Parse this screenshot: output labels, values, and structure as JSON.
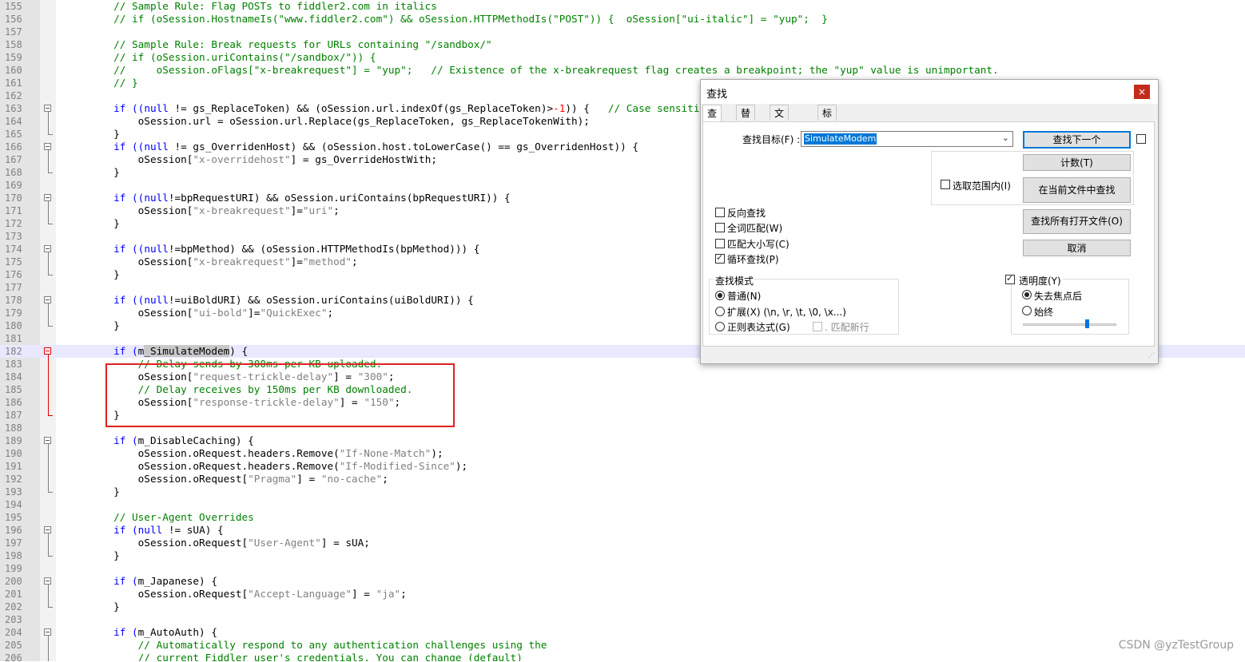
{
  "editor": {
    "lines": [
      {
        "n": "155",
        "tokens": [
          {
            "t": "comment",
            "v": "        // Sample Rule: Flag POSTs to fiddler2.com in italics"
          }
        ]
      },
      {
        "n": "156",
        "tokens": [
          {
            "t": "comment",
            "v": "        // if (oSession.HostnameIs(\"www.fiddler2.com\") && oSession.HTTPMethodIs(\"POST\")) {  oSession[\"ui-italic\"] = \"yup\";  }"
          }
        ]
      },
      {
        "n": "157",
        "tokens": []
      },
      {
        "n": "158",
        "tokens": [
          {
            "t": "comment",
            "v": "        // Sample Rule: Break requests for URLs containing \"/sandbox/\""
          }
        ]
      },
      {
        "n": "159",
        "tokens": [
          {
            "t": "comment",
            "v": "        // if (oSession.uriContains(\"/sandbox/\")) {"
          }
        ]
      },
      {
        "n": "160",
        "tokens": [
          {
            "t": "comment",
            "v": "        //     oSession.oFlags[\"x-breakrequest\"] = \"yup\";   // Existence of the x-breakrequest flag creates a breakpoint; the \"yup\" value is unimportant."
          }
        ]
      },
      {
        "n": "161",
        "tokens": [
          {
            "t": "comment",
            "v": "        // }"
          }
        ]
      },
      {
        "n": "162",
        "tokens": []
      },
      {
        "n": "163",
        "fold": "start",
        "tokens": [
          {
            "t": "kw",
            "v": "        if (("
          },
          {
            "t": "kw",
            "v": "null"
          },
          {
            "t": "text",
            "v": " != gs_ReplaceToken) && (oSession.url.indexOf(gs_ReplaceToken)>"
          },
          {
            "t": "num",
            "v": "-1"
          },
          {
            "t": "text",
            "v": ")) {   "
          },
          {
            "t": "comment",
            "v": "// Case sensitive"
          }
        ]
      },
      {
        "n": "164",
        "tokens": [
          {
            "t": "text",
            "v": "            oSession.url = oSession.url.Replace(gs_ReplaceToken, gs_ReplaceTokenWith);"
          }
        ]
      },
      {
        "n": "165",
        "fold": "end",
        "tokens": [
          {
            "t": "text",
            "v": "        }"
          }
        ]
      },
      {
        "n": "166",
        "fold": "start",
        "tokens": [
          {
            "t": "kw",
            "v": "        if (("
          },
          {
            "t": "kw",
            "v": "null"
          },
          {
            "t": "text",
            "v": " != gs_OverridenHost) && (oSession.host.toLowerCase() == gs_OverridenHost)) {"
          }
        ]
      },
      {
        "n": "167",
        "tokens": [
          {
            "t": "text",
            "v": "            oSession["
          },
          {
            "t": "str",
            "v": "\"x-overridehost\""
          },
          {
            "t": "text",
            "v": "] = gs_OverrideHostWith;"
          }
        ]
      },
      {
        "n": "168",
        "fold": "end",
        "tokens": [
          {
            "t": "text",
            "v": "        }"
          }
        ]
      },
      {
        "n": "169",
        "tokens": []
      },
      {
        "n": "170",
        "fold": "start",
        "tokens": [
          {
            "t": "kw",
            "v": "        if (("
          },
          {
            "t": "kw",
            "v": "null"
          },
          {
            "t": "text",
            "v": "!=bpRequestURI) && oSession.uriContains(bpRequestURI)) {"
          }
        ]
      },
      {
        "n": "171",
        "tokens": [
          {
            "t": "text",
            "v": "            oSession["
          },
          {
            "t": "str",
            "v": "\"x-breakrequest\""
          },
          {
            "t": "text",
            "v": "]="
          },
          {
            "t": "str",
            "v": "\"uri\""
          },
          {
            "t": "text",
            "v": ";"
          }
        ]
      },
      {
        "n": "172",
        "fold": "end",
        "tokens": [
          {
            "t": "text",
            "v": "        }"
          }
        ]
      },
      {
        "n": "173",
        "tokens": []
      },
      {
        "n": "174",
        "fold": "start",
        "tokens": [
          {
            "t": "kw",
            "v": "        if (("
          },
          {
            "t": "kw",
            "v": "null"
          },
          {
            "t": "text",
            "v": "!=bpMethod) && (oSession.HTTPMethodIs(bpMethod))) {"
          }
        ]
      },
      {
        "n": "175",
        "tokens": [
          {
            "t": "text",
            "v": "            oSession["
          },
          {
            "t": "str",
            "v": "\"x-breakrequest\""
          },
          {
            "t": "text",
            "v": "]="
          },
          {
            "t": "str",
            "v": "\"method\""
          },
          {
            "t": "text",
            "v": ";"
          }
        ]
      },
      {
        "n": "176",
        "fold": "end",
        "tokens": [
          {
            "t": "text",
            "v": "        }"
          }
        ]
      },
      {
        "n": "177",
        "tokens": []
      },
      {
        "n": "178",
        "fold": "start",
        "tokens": [
          {
            "t": "kw",
            "v": "        if (("
          },
          {
            "t": "kw",
            "v": "null"
          },
          {
            "t": "text",
            "v": "!=uiBoldURI) && oSession.uriContains(uiBoldURI)) {"
          }
        ]
      },
      {
        "n": "179",
        "tokens": [
          {
            "t": "text",
            "v": "            oSession["
          },
          {
            "t": "str",
            "v": "\"ui-bold\""
          },
          {
            "t": "text",
            "v": "]="
          },
          {
            "t": "str",
            "v": "\"QuickExec\""
          },
          {
            "t": "text",
            "v": ";"
          }
        ]
      },
      {
        "n": "180",
        "fold": "end",
        "tokens": [
          {
            "t": "text",
            "v": "        }"
          }
        ]
      },
      {
        "n": "181",
        "tokens": []
      },
      {
        "n": "182",
        "fold": "start-red",
        "current": true,
        "tokens": [
          {
            "t": "kw",
            "v": "        if ("
          },
          {
            "t": "text",
            "v": "m"
          },
          {
            "t": "hl",
            "v": "_SimulateModem"
          },
          {
            "t": "text",
            "v": ") {"
          }
        ]
      },
      {
        "n": "183",
        "tokens": [
          {
            "t": "comment",
            "v": "            // Delay sends by 300ms per KB uploaded."
          }
        ]
      },
      {
        "n": "184",
        "tokens": [
          {
            "t": "text",
            "v": "            oSession["
          },
          {
            "t": "str",
            "v": "\"request-trickle-delay\""
          },
          {
            "t": "text",
            "v": "] = "
          },
          {
            "t": "str",
            "v": "\"300\""
          },
          {
            "t": "text",
            "v": ";"
          }
        ]
      },
      {
        "n": "185",
        "tokens": [
          {
            "t": "comment",
            "v": "            // Delay receives by 150ms per KB downloaded."
          }
        ]
      },
      {
        "n": "186",
        "tokens": [
          {
            "t": "text",
            "v": "            oSession["
          },
          {
            "t": "str",
            "v": "\"response-trickle-delay\""
          },
          {
            "t": "text",
            "v": "] = "
          },
          {
            "t": "str",
            "v": "\"150\""
          },
          {
            "t": "text",
            "v": ";"
          }
        ]
      },
      {
        "n": "187",
        "fold": "end-red",
        "tokens": [
          {
            "t": "text",
            "v": "        }"
          }
        ]
      },
      {
        "n": "188",
        "tokens": []
      },
      {
        "n": "189",
        "fold": "start",
        "tokens": [
          {
            "t": "kw",
            "v": "        if ("
          },
          {
            "t": "text",
            "v": "m_DisableCaching) {"
          }
        ]
      },
      {
        "n": "190",
        "tokens": [
          {
            "t": "text",
            "v": "            oSession.oRequest.headers.Remove("
          },
          {
            "t": "str",
            "v": "\"If-None-Match\""
          },
          {
            "t": "text",
            "v": ");"
          }
        ]
      },
      {
        "n": "191",
        "tokens": [
          {
            "t": "text",
            "v": "            oSession.oRequest.headers.Remove("
          },
          {
            "t": "str",
            "v": "\"If-Modified-Since\""
          },
          {
            "t": "text",
            "v": ");"
          }
        ]
      },
      {
        "n": "192",
        "tokens": [
          {
            "t": "text",
            "v": "            oSession.oRequest["
          },
          {
            "t": "str",
            "v": "\"Pragma\""
          },
          {
            "t": "text",
            "v": "] = "
          },
          {
            "t": "str",
            "v": "\"no-cache\""
          },
          {
            "t": "text",
            "v": ";"
          }
        ]
      },
      {
        "n": "193",
        "fold": "end",
        "tokens": [
          {
            "t": "text",
            "v": "        }"
          }
        ]
      },
      {
        "n": "194",
        "tokens": []
      },
      {
        "n": "195",
        "tokens": [
          {
            "t": "comment",
            "v": "        // User-Agent Overrides"
          }
        ]
      },
      {
        "n": "196",
        "fold": "start",
        "tokens": [
          {
            "t": "kw",
            "v": "        if ("
          },
          {
            "t": "kw",
            "v": "null"
          },
          {
            "t": "text",
            "v": " != sUA) {"
          }
        ]
      },
      {
        "n": "197",
        "tokens": [
          {
            "t": "text",
            "v": "            oSession.oRequest["
          },
          {
            "t": "str",
            "v": "\"User-Agent\""
          },
          {
            "t": "text",
            "v": "] = sUA;"
          }
        ]
      },
      {
        "n": "198",
        "fold": "end",
        "tokens": [
          {
            "t": "text",
            "v": "        }"
          }
        ]
      },
      {
        "n": "199",
        "tokens": []
      },
      {
        "n": "200",
        "fold": "start",
        "tokens": [
          {
            "t": "kw",
            "v": "        if ("
          },
          {
            "t": "text",
            "v": "m_Japanese) {"
          }
        ]
      },
      {
        "n": "201",
        "tokens": [
          {
            "t": "text",
            "v": "            oSession.oRequest["
          },
          {
            "t": "str",
            "v": "\"Accept-Language\""
          },
          {
            "t": "text",
            "v": "] = "
          },
          {
            "t": "str",
            "v": "\"ja\""
          },
          {
            "t": "text",
            "v": ";"
          }
        ]
      },
      {
        "n": "202",
        "fold": "end",
        "tokens": [
          {
            "t": "text",
            "v": "        }"
          }
        ]
      },
      {
        "n": "203",
        "tokens": []
      },
      {
        "n": "204",
        "fold": "start",
        "tokens": [
          {
            "t": "kw",
            "v": "        if ("
          },
          {
            "t": "text",
            "v": "m_AutoAuth) {"
          }
        ]
      },
      {
        "n": "205",
        "tokens": [
          {
            "t": "comment",
            "v": "            // Automatically respond to any authentication challenges using the"
          }
        ]
      },
      {
        "n": "206",
        "tokens": [
          {
            "t": "comment",
            "v": "            // current Fiddler user's credentials. You can change (default)"
          }
        ]
      }
    ]
  },
  "colors": {
    "comment": "#008000",
    "keyword": "#0000ff",
    "string": "#808080",
    "number": "#ff0000",
    "annotation": "#e02020",
    "accent": "#0078d7"
  },
  "find_dialog": {
    "title": "查找",
    "close_icon": "close-icon",
    "tabs": [
      {
        "label": "查找",
        "active": true
      },
      {
        "label": "替换",
        "active": false
      },
      {
        "label": "文件查找",
        "active": false
      },
      {
        "label": "标记",
        "active": false
      }
    ],
    "target_label": "查找目标(F) :",
    "target_value": "SimulateModem",
    "buttons": {
      "find_next": "查找下一个",
      "count": "计数(T)",
      "find_in_current": "在当前文件中查找",
      "find_all_open": "查找所有打开文件(O)",
      "cancel": "取消"
    },
    "in_selection": {
      "label": "选取范围内(I)",
      "checked": false
    },
    "options": [
      {
        "label": "反向查找",
        "checked": false
      },
      {
        "label": "全词匹配(W)",
        "checked": false
      },
      {
        "label": "匹配大小写(C)",
        "checked": false
      },
      {
        "label": "循环查找(P)",
        "checked": true
      }
    ],
    "search_mode": {
      "title": "查找模式",
      "options": [
        {
          "label": "普通(N)",
          "selected": true
        },
        {
          "label": "扩展(X) (\\n, \\r, \\t, \\0, \\x...)",
          "selected": false
        },
        {
          "label": "正则表达式(G)",
          "selected": false
        }
      ],
      "match_newline": {
        "label": ". 匹配新行",
        "checked": false
      }
    },
    "transparency": {
      "label": "透明度(Y)",
      "checked": true,
      "options": [
        {
          "label": "失去焦点后",
          "selected": true
        },
        {
          "label": "始终",
          "selected": false
        }
      ],
      "slider_value": 0.7
    }
  },
  "watermark": "CSDN @yzTestGroup"
}
